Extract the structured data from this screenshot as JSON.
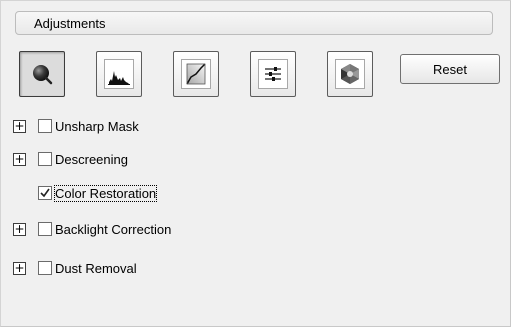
{
  "adjustments": {
    "title": "Adjustments",
    "tools": [
      {
        "name": "unsharp-mask-tool",
        "icon": "sphere-icon"
      },
      {
        "name": "histogram-tool",
        "icon": "histogram-icon"
      },
      {
        "name": "tone-curve-tool",
        "icon": "tone-curve-icon"
      },
      {
        "name": "image-adjustment-tool",
        "icon": "sliders-icon"
      },
      {
        "name": "color-palette-tool",
        "icon": "color-palette-icon"
      }
    ],
    "reset_label": "Reset",
    "options": [
      {
        "label": "Unsharp Mask",
        "checked": false,
        "expandable": true
      },
      {
        "label": "Descreening",
        "checked": false,
        "expandable": true
      },
      {
        "label": "Color Restoration",
        "checked": true,
        "expandable": false
      },
      {
        "label": "Backlight Correction",
        "checked": false,
        "expandable": true
      },
      {
        "label": "Dust Removal",
        "checked": false,
        "expandable": true
      }
    ]
  }
}
